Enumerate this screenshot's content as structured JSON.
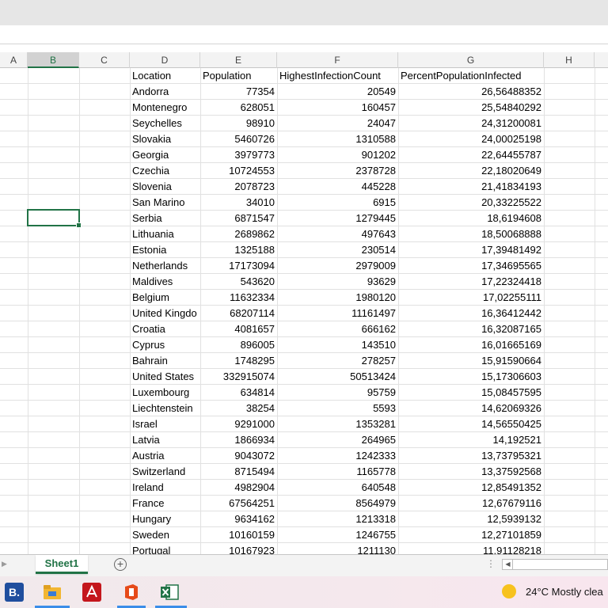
{
  "columns": [
    "A",
    "B",
    "C",
    "D",
    "E",
    "F",
    "G",
    "H"
  ],
  "selected_column": "B",
  "sheet": {
    "headers": {
      "location": "Location",
      "population": "Population",
      "highest": "HighestInfectionCount",
      "percent": "PercentPopulationInfected"
    },
    "rows": [
      {
        "location": "Andorra",
        "population": "77354",
        "highest": "20549",
        "percent": "26,56488352"
      },
      {
        "location": "Montenegro",
        "population": "628051",
        "highest": "160457",
        "percent": "25,54840292"
      },
      {
        "location": "Seychelles",
        "population": "98910",
        "highest": "24047",
        "percent": "24,31200081"
      },
      {
        "location": "Slovakia",
        "population": "5460726",
        "highest": "1310588",
        "percent": "24,00025198"
      },
      {
        "location": "Georgia",
        "population": "3979773",
        "highest": "901202",
        "percent": "22,64455787"
      },
      {
        "location": "Czechia",
        "population": "10724553",
        "highest": "2378728",
        "percent": "22,18020649"
      },
      {
        "location": "Slovenia",
        "population": "2078723",
        "highest": "445228",
        "percent": "21,41834193"
      },
      {
        "location": "San Marino",
        "population": "34010",
        "highest": "6915",
        "percent": "20,33225522"
      },
      {
        "location": "Serbia",
        "population": "6871547",
        "highest": "1279445",
        "percent": "18,6194608"
      },
      {
        "location": "Lithuania",
        "population": "2689862",
        "highest": "497643",
        "percent": "18,50068888"
      },
      {
        "location": "Estonia",
        "population": "1325188",
        "highest": "230514",
        "percent": "17,39481492"
      },
      {
        "location": "Netherlands",
        "population": "17173094",
        "highest": "2979009",
        "percent": "17,34695565"
      },
      {
        "location": "Maldives",
        "population": "543620",
        "highest": "93629",
        "percent": "17,22324418"
      },
      {
        "location": "Belgium",
        "population": "11632334",
        "highest": "1980120",
        "percent": "17,02255111"
      },
      {
        "location": "United Kingdo",
        "population": "68207114",
        "highest": "11161497",
        "percent": "16,36412442"
      },
      {
        "location": "Croatia",
        "population": "4081657",
        "highest": "666162",
        "percent": "16,32087165"
      },
      {
        "location": "Cyprus",
        "population": "896005",
        "highest": "143510",
        "percent": "16,01665169"
      },
      {
        "location": "Bahrain",
        "population": "1748295",
        "highest": "278257",
        "percent": "15,91590664"
      },
      {
        "location": "United States",
        "population": "332915074",
        "highest": "50513424",
        "percent": "15,17306603"
      },
      {
        "location": "Luxembourg",
        "population": "634814",
        "highest": "95759",
        "percent": "15,08457595"
      },
      {
        "location": "Liechtenstein",
        "population": "38254",
        "highest": "5593",
        "percent": "14,62069326"
      },
      {
        "location": "Israel",
        "population": "9291000",
        "highest": "1353281",
        "percent": "14,56550425"
      },
      {
        "location": "Latvia",
        "population": "1866934",
        "highest": "264965",
        "percent": "14,192521"
      },
      {
        "location": "Austria",
        "population": "9043072",
        "highest": "1242333",
        "percent": "13,73795321"
      },
      {
        "location": "Switzerland",
        "population": "8715494",
        "highest": "1165778",
        "percent": "13,37592568"
      },
      {
        "location": "Ireland",
        "population": "4982904",
        "highest": "640548",
        "percent": "12,85491352"
      },
      {
        "location": "France",
        "population": "67564251",
        "highest": "8564979",
        "percent": "12,67679116"
      },
      {
        "location": "Hungary",
        "population": "9634162",
        "highest": "1213318",
        "percent": "12,5939132"
      },
      {
        "location": "Sweden",
        "population": "10160159",
        "highest": "1246755",
        "percent": "12,27101859"
      },
      {
        "location": "Portugal",
        "population": "10167923",
        "highest": "1211130",
        "percent": "11,91128218"
      }
    ]
  },
  "sheet_tab": "Sheet1",
  "add_sheet_symbol": "+",
  "taskbar": {
    "apps": [
      {
        "name": "b-app",
        "glyph": "B.",
        "color": "#1f4e9e"
      },
      {
        "name": "file-explorer",
        "glyph": "",
        "color": "#f2b632"
      },
      {
        "name": "acrobat",
        "glyph": "",
        "color": "#c4161c"
      },
      {
        "name": "office",
        "glyph": "",
        "color": "#e64a19"
      },
      {
        "name": "excel",
        "glyph": "X",
        "color": "#217346"
      }
    ],
    "weather": "24°C  Mostly clea"
  },
  "colors": {
    "accent": "#217346"
  }
}
